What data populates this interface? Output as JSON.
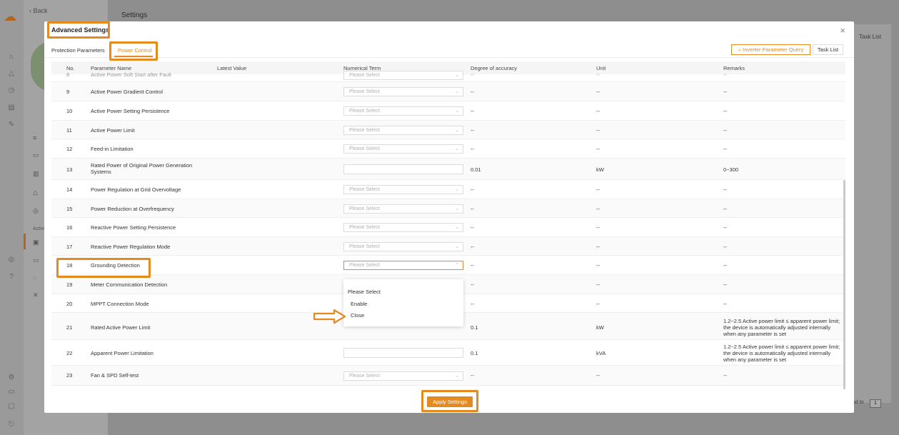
{
  "background": {
    "back_label": "Back",
    "page_title": "Settings",
    "task_list_label": "Task List",
    "pager_label": "ad to",
    "pager_value": "1",
    "side_active_label": "Active"
  },
  "modal": {
    "title": "Advanced Settings",
    "close_icon": "×",
    "tabs": [
      {
        "label": "Protection Parameters",
        "active": false
      },
      {
        "label": "Power Control",
        "active": true
      }
    ],
    "inverter_query_label": "Inverter Parameter Query",
    "task_list_label": "Task List",
    "apply_label": "Apply Settings"
  },
  "table": {
    "columns": [
      "No.",
      "Parameter Name",
      "Latest Value",
      "Numerical Term",
      "Degree of accuracy",
      "Unit",
      "Remarks"
    ],
    "partial_row": {
      "no": "8",
      "name": "Active Power Soft Start after Fault",
      "select": "Please Select",
      "accuracy": "--",
      "unit": "--",
      "remarks": "--"
    },
    "rows": [
      {
        "no": "9",
        "name": "Active Power Gradient Control",
        "type": "select",
        "value": "Please Select",
        "accuracy": "--",
        "unit": "--",
        "remarks": "--"
      },
      {
        "no": "10",
        "name": "Active Power Setting Persistence",
        "type": "select",
        "value": "Please Select",
        "accuracy": "--",
        "unit": "--",
        "remarks": "--"
      },
      {
        "no": "11",
        "name": "Active Power Limit",
        "type": "select",
        "value": "Please Select",
        "accuracy": "--",
        "unit": "--",
        "remarks": "--"
      },
      {
        "no": "12",
        "name": "Feed-in Limitation",
        "type": "select",
        "value": "Please Select",
        "accuracy": "--",
        "unit": "--",
        "remarks": "--"
      },
      {
        "no": "13",
        "name": "Rated Power of Original Power Generation Systems",
        "type": "input",
        "value": "",
        "accuracy": "0.01",
        "unit": "kW",
        "remarks": "0~300"
      },
      {
        "no": "14",
        "name": "Power Regulation at Grid Overvoltage",
        "type": "select",
        "value": "Please Select",
        "accuracy": "--",
        "unit": "--",
        "remarks": "--"
      },
      {
        "no": "15",
        "name": "Power Reduction at Overfrequency",
        "type": "select",
        "value": "Please Select",
        "accuracy": "--",
        "unit": "--",
        "remarks": "--"
      },
      {
        "no": "16",
        "name": "Reactive Power Setting Persistence",
        "type": "select",
        "value": "Please Select",
        "accuracy": "--",
        "unit": "--",
        "remarks": "--"
      },
      {
        "no": "17",
        "name": "Reactive Power Regulation Mode",
        "type": "select",
        "value": "Please Select",
        "accuracy": "--",
        "unit": "--",
        "remarks": "--"
      },
      {
        "no": "18",
        "name": "Grounding Detection",
        "type": "select",
        "value": "Please Select",
        "accuracy": "--",
        "unit": "--",
        "remarks": "--"
      },
      {
        "no": "19",
        "name": "Meter Communication Detection",
        "type": "none",
        "value": "",
        "accuracy": "--",
        "unit": "--",
        "remarks": "--"
      },
      {
        "no": "20",
        "name": "MPPT Connection Mode",
        "type": "none",
        "value": "",
        "accuracy": "--",
        "unit": "--",
        "remarks": "--"
      },
      {
        "no": "21",
        "name": "Rated Active Power Limit",
        "type": "none",
        "value": "",
        "accuracy": "0.1",
        "unit": "kW",
        "remarks": "1.2~2.5 Active power limit ≤ apparent power limit; the device is automatically adjusted internally when any parameter is set"
      },
      {
        "no": "22",
        "name": "Apparent Power Limitation",
        "type": "input",
        "value": "",
        "accuracy": "0.1",
        "unit": "kVA",
        "remarks": "1.2~2.5 Active power limit ≤ apparent power limit; the device is automatically adjusted internally when any parameter is set"
      },
      {
        "no": "23",
        "name": "Fan & SPD Self-test",
        "type": "select",
        "value": "Please Select",
        "accuracy": "--",
        "unit": "--",
        "remarks": "--"
      }
    ]
  },
  "dropdown": {
    "options": [
      "Please Select",
      "Enable",
      "Close"
    ]
  },
  "colors": {
    "accent": "#e58a1f"
  }
}
